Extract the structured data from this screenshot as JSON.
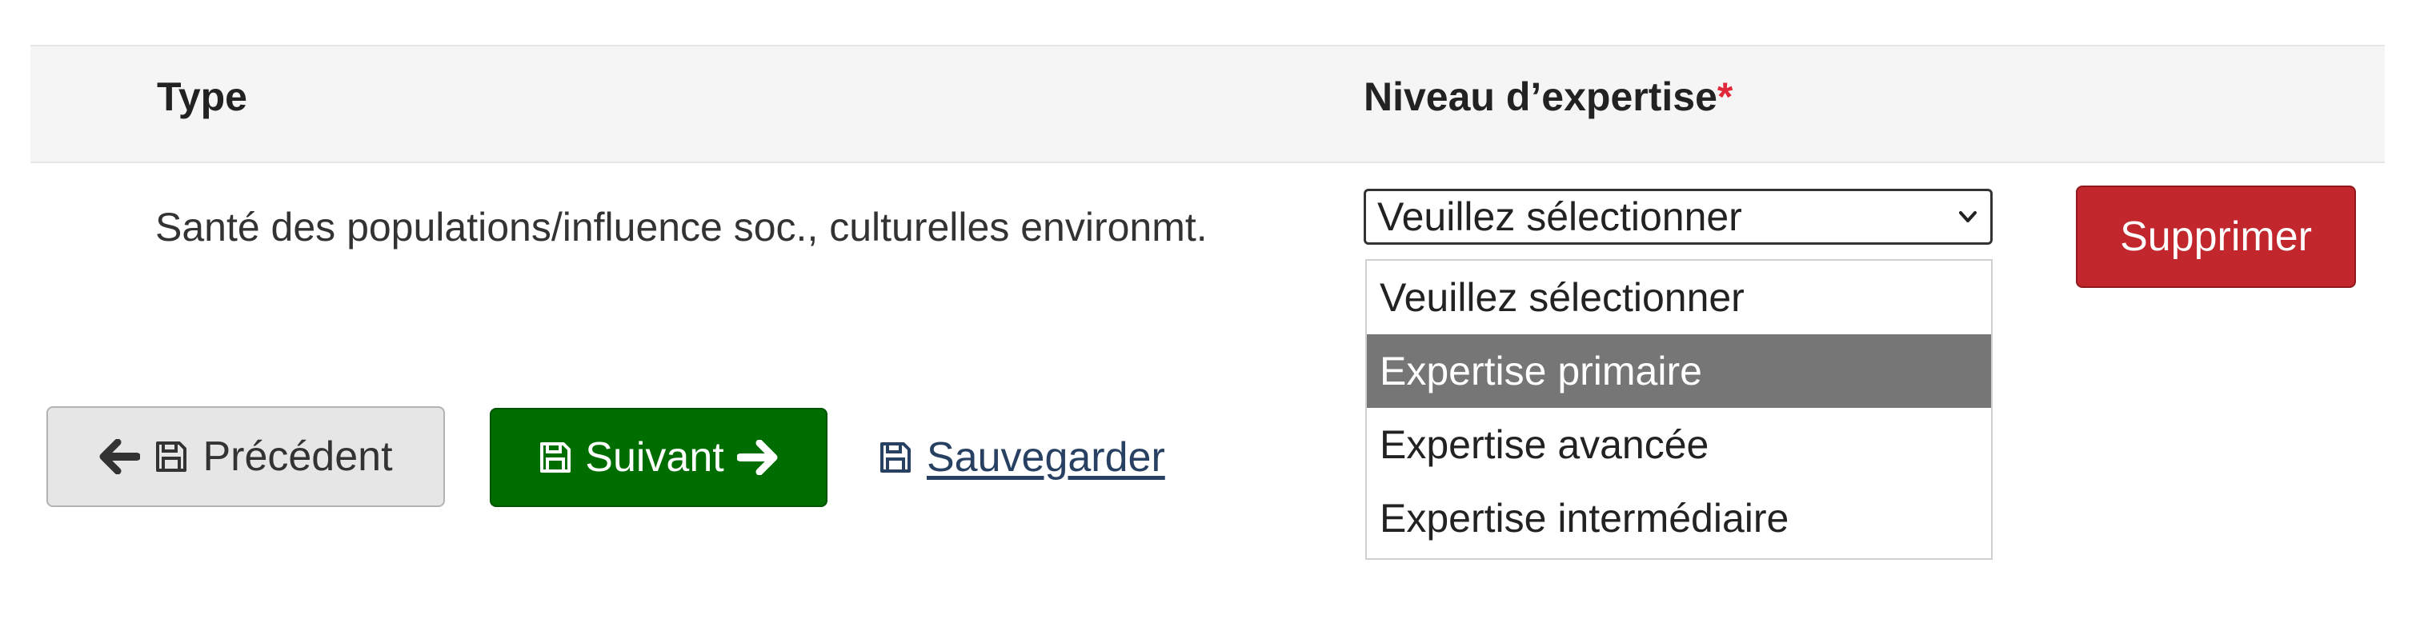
{
  "table": {
    "headers": {
      "type": "Type",
      "level": "Niveau d’expertise",
      "required_marker": "*"
    },
    "rows": [
      {
        "type_value": "Santé des populations/influence soc., culturelles environmt.",
        "level_select": {
          "selected_value": "Veuillez sélectionner",
          "options": [
            "Veuillez sélectionner",
            "Expertise primaire",
            "Expertise avancée",
            "Expertise intermédiaire"
          ],
          "highlighted_option": "Expertise primaire"
        },
        "delete_label": "Supprimer"
      }
    ]
  },
  "navigation": {
    "previous_label": "Précédent",
    "next_label": "Suivant",
    "save_label": "Sauvegarder"
  },
  "colors": {
    "header_background": "#f5f5f5",
    "required_star": "#e0283a",
    "delete_button": "#c1272d",
    "next_button": "#006d00",
    "previous_button": "#e6e6e6",
    "highlighted_option": "#767676",
    "link": "#284162"
  },
  "icons": {
    "previous": [
      "arrow-left-icon",
      "floppy-disk-icon"
    ],
    "next": [
      "floppy-disk-icon",
      "arrow-right-icon"
    ],
    "save": [
      "floppy-disk-icon"
    ],
    "select": [
      "chevron-down-icon"
    ]
  }
}
